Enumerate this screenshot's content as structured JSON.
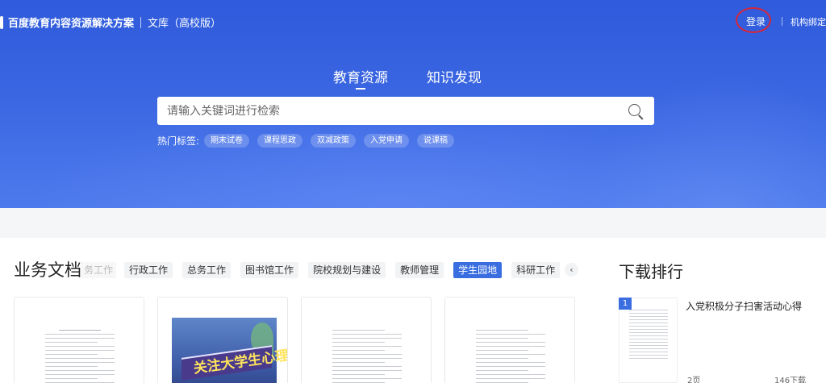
{
  "header": {
    "brand_main": "百度教育内容资源解决方案",
    "brand_sub": "文库（高校版）",
    "login": "登录",
    "bind": "机构绑定"
  },
  "main_tabs": [
    {
      "label": "教育资源",
      "active": true
    },
    {
      "label": "知识发现",
      "active": false
    }
  ],
  "search": {
    "placeholder": "请输入关键词进行检索"
  },
  "hot": {
    "label": "热门标签:",
    "tags": [
      "期末试卷",
      "课程思政",
      "双减政策",
      "入党申请",
      "说课稿"
    ]
  },
  "business": {
    "title": "业务文档",
    "categories": [
      {
        "label": "务工作",
        "faded": true
      },
      {
        "label": "行政工作"
      },
      {
        "label": "总务工作"
      },
      {
        "label": "图书馆工作"
      },
      {
        "label": "院校规划与建设"
      },
      {
        "label": "教师管理"
      },
      {
        "label": "学生园地",
        "active": true
      },
      {
        "label": "科研工作"
      }
    ],
    "prev_icon": "‹",
    "poster_text": "关注大学生心理健康"
  },
  "ranking": {
    "title": "下载排行",
    "items": [
      {
        "rank": "1",
        "name": "入党积极分子扫害活动心得",
        "pages": "2页",
        "downloads": "146下载"
      }
    ]
  },
  "colors": {
    "accent": "#3a6ee0",
    "hero": "#3a66e2",
    "login_circle": "#d3263a"
  }
}
